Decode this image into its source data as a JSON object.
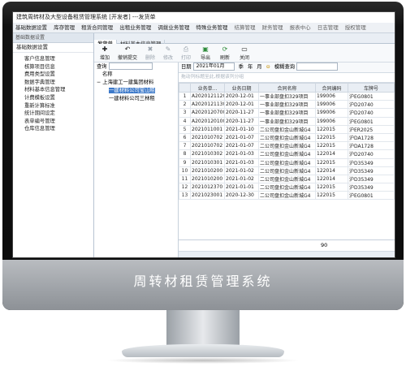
{
  "app": {
    "title": "建筑周转材及大型设备租赁管理系统 [开发者] ---发货单",
    "menus": [
      "基础数据设置",
      "库存管理",
      "租赁合同管理",
      "出租业务管理",
      "调拨业务管理",
      "特殊业务管理",
      "结算管理",
      "财务管理",
      "报表中心",
      "日志管理",
      "授权管理"
    ]
  },
  "left": {
    "header": "基础数据设置",
    "subheader": "基础数据设置",
    "items": [
      "客户信息管理",
      "核算项目信息",
      "费用类型设置",
      "数据字典管理",
      "材料基本信息管理",
      "计费模板设置",
      "重新计算标准",
      "统计期间设定",
      "表单编号管理",
      "仓库信息管理"
    ]
  },
  "tabs": [
    "发货单",
    "材料基本信息管理"
  ],
  "toolbar": {
    "add": "增加",
    "withdraw": "撤销提交",
    "delete": "删除",
    "edit": "修改",
    "print": "打印",
    "export": "导出",
    "refresh": "刷新",
    "close": "关闭"
  },
  "tree": {
    "query_label": "查询",
    "name_header": "名称",
    "nodes": [
      "上海建工一建集团材料",
      "一建材料公司宝山租",
      "一建材料公司三林租"
    ]
  },
  "filter": {
    "date_label": "日期",
    "month": "2021年01月",
    "quarter": "季",
    "year": "年",
    "period_marker": "月",
    "fuzzy_label": "模糊查询"
  },
  "grid": {
    "hint": "拖动列标题至此,根据该列分组",
    "columns": [
      "",
      "业务单...",
      "业务日期",
      "合同名称",
      "合同编码",
      "车牌号"
    ],
    "rows": [
      [
        "1",
        "A2020121120",
        "2020-12-01",
        "一事业部盘扣329项目",
        "199006",
        "沪EG0801"
      ],
      [
        "2",
        "A2020121130",
        "2020-12-01",
        "一事业部盘扣329项目",
        "199006",
        "沪D20740"
      ],
      [
        "3",
        "A2020120700",
        "2020-11-27",
        "一事业部盘扣329项目",
        "199006",
        "沪D20740"
      ],
      [
        "4",
        "A2020120100",
        "2020-11-27",
        "一事业部盘扣329项目",
        "199006",
        "沪EG0801"
      ],
      [
        "5",
        "2021011001",
        "2021-01-10",
        "二公司盘扣金山新城G4",
        "122015",
        "沪ER2025"
      ],
      [
        "6",
        "2021010702",
        "2021-01-07",
        "二公司盘扣金山新城G4",
        "122015",
        "沪DA1728"
      ],
      [
        "7",
        "2021010702",
        "2021-01-07",
        "二公司盘扣金山新城G4",
        "122015",
        "沪DA1728"
      ],
      [
        "8",
        "2021010302",
        "2021-01-03",
        "二公司盘扣金山新城G4",
        "122014",
        "沪D20740"
      ],
      [
        "9",
        "2021010301",
        "2021-01-03",
        "二公司盘扣金山新城G4",
        "122015",
        "沪D35349"
      ],
      [
        "10",
        "2021010200",
        "2021-01-02",
        "二公司盘扣金山新城G4",
        "122014",
        "沪D35349"
      ],
      [
        "11",
        "2021010200",
        "2021-01-02",
        "二公司盘扣金山新城G4",
        "122014",
        "沪D35349"
      ],
      [
        "12",
        "2021012370",
        "2021-01-01",
        "二公司盘扣金山新城G4",
        "122015",
        "沪D35349"
      ],
      [
        "13",
        "2021023001",
        "2020-12-30",
        "二公司盘扣金山新城G4",
        "122015",
        "沪EG0801"
      ]
    ],
    "total": "90"
  },
  "banner": "周转材租赁管理系统"
}
